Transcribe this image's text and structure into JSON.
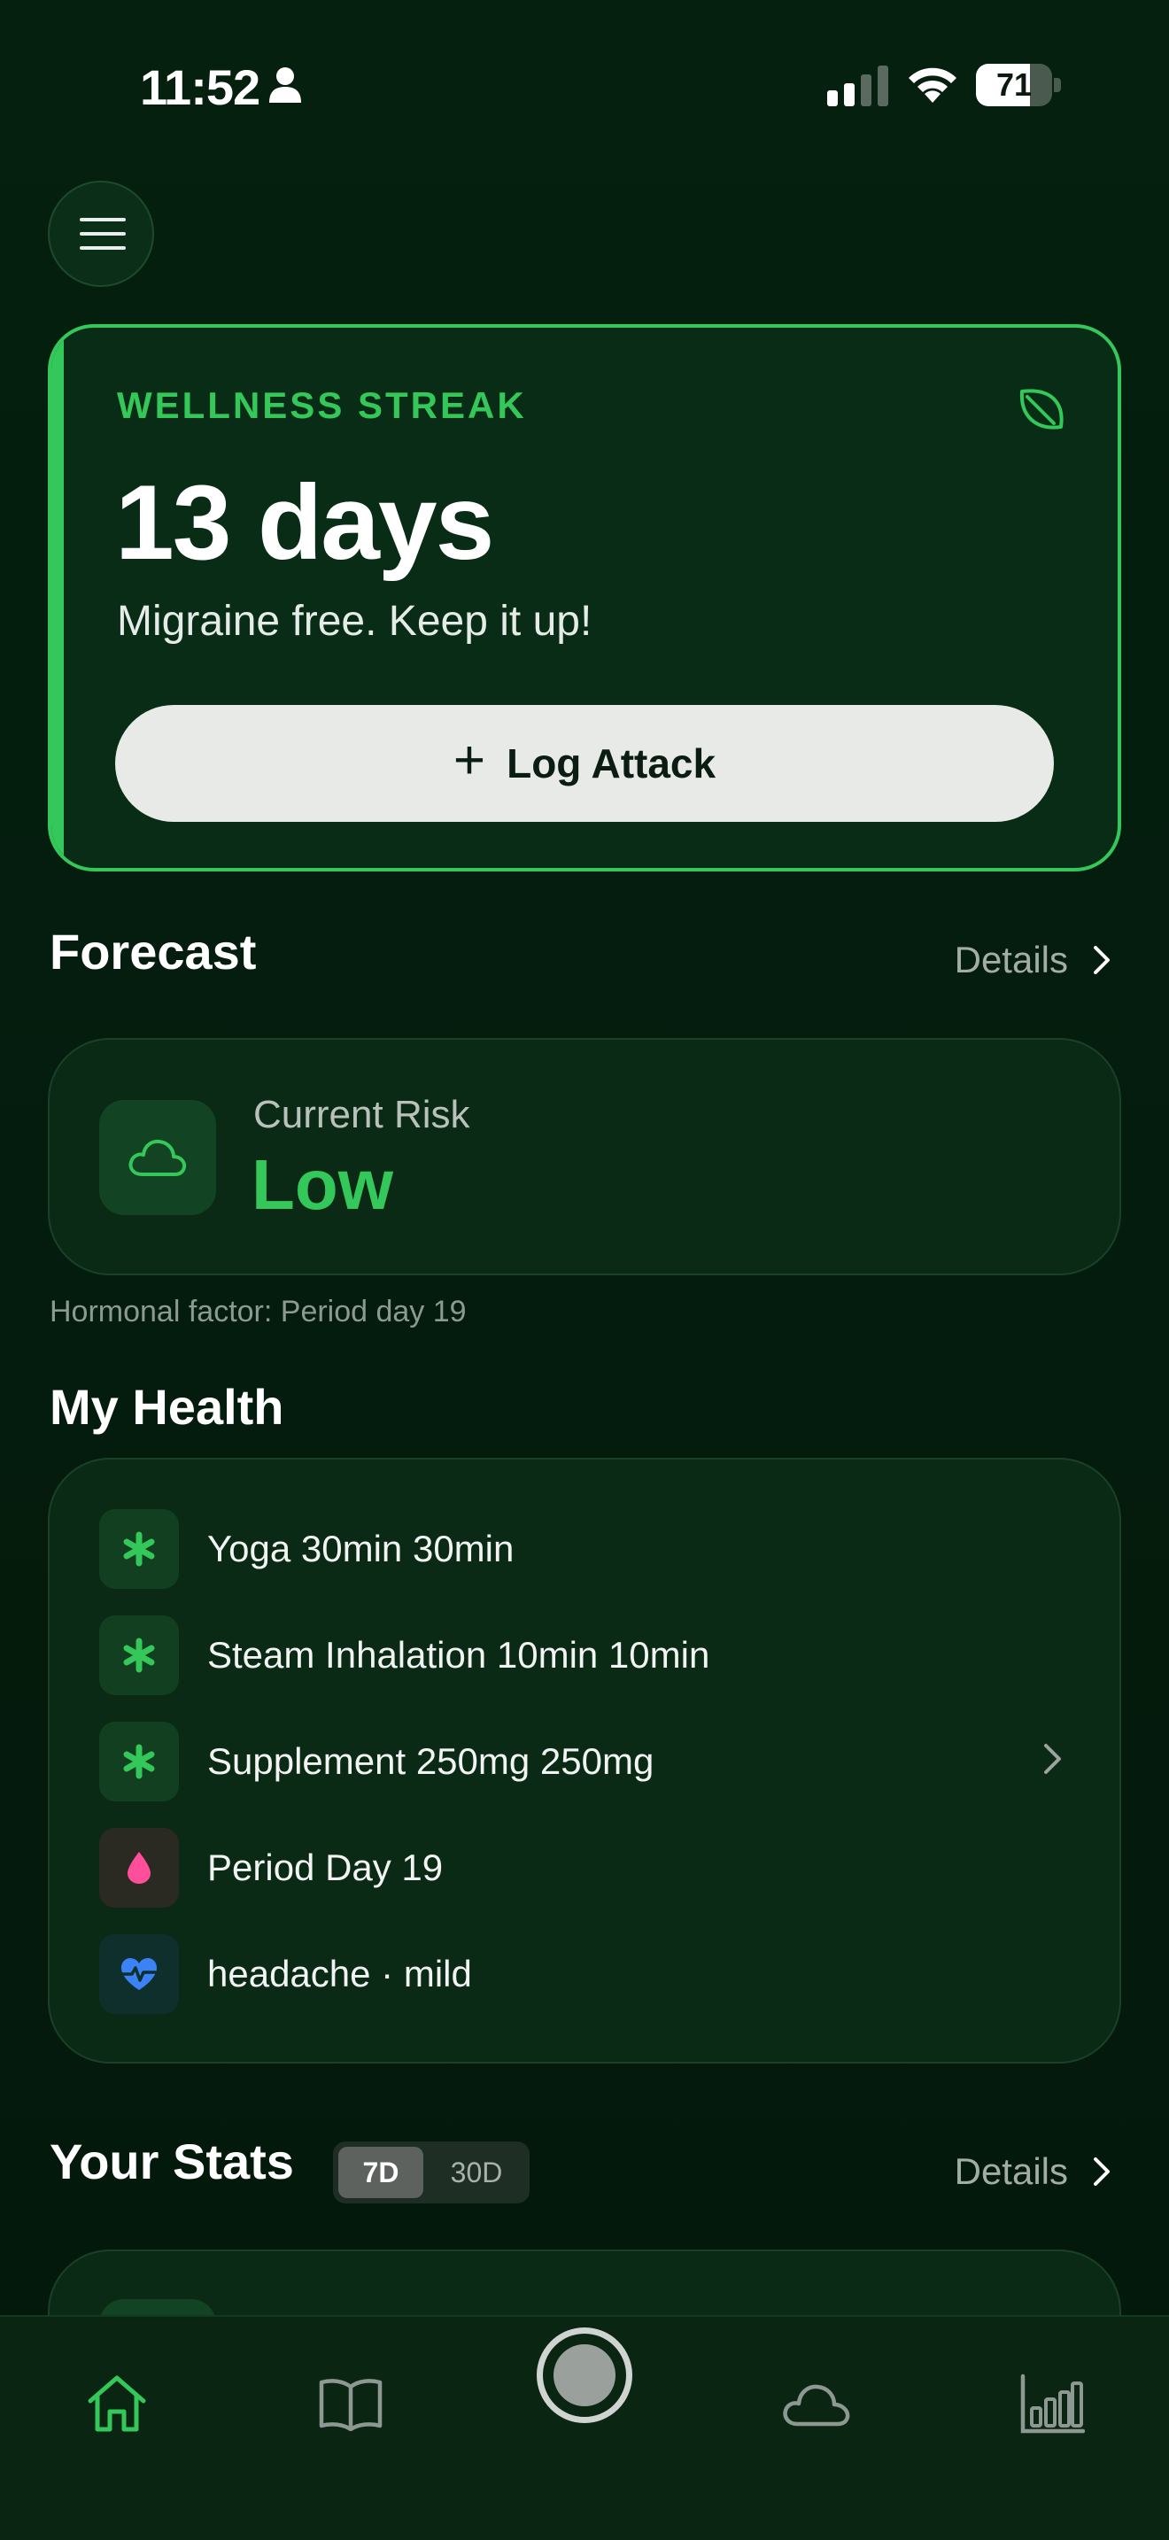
{
  "status_bar": {
    "time": "11:52",
    "battery": "71",
    "battery_level": 0.71
  },
  "menu": {
    "icon": "hamburger-menu-icon"
  },
  "streak": {
    "label": "WELLNESS STREAK",
    "count": "13 days",
    "subtitle": "Migraine free. Keep it up!",
    "log_button": "Log Attack",
    "icon": "leaf-icon",
    "accent_color": "#34c759"
  },
  "forecast": {
    "title": "Forecast",
    "details": "Details",
    "risk_label": "Current Risk",
    "risk_value": "Low",
    "note": "Hormonal factor: Period day 19",
    "icon": "cloud-icon"
  },
  "health": {
    "title": "My Health",
    "items": [
      {
        "label": "Yoga 30min 30min",
        "icon": "asterisk-icon",
        "color": "#34c759"
      },
      {
        "label": "Steam Inhalation 10min 10min",
        "icon": "asterisk-icon",
        "color": "#34c759"
      },
      {
        "label": "Supplement 250mg 250mg",
        "icon": "asterisk-icon",
        "color": "#34c759"
      },
      {
        "label": "Period Day 19",
        "icon": "drop-icon",
        "color": "#ff4f9a"
      },
      {
        "label": "headache · mild",
        "icon": "heart-pulse-icon",
        "color": "#3b82f6"
      }
    ]
  },
  "stats": {
    "title": "Your Stats",
    "details": "Details",
    "ranges": [
      "7D",
      "30D"
    ],
    "selected_range": "7D"
  },
  "tab_bar": {
    "tabs": [
      "home-icon",
      "book-icon",
      "record-button",
      "cloud-icon",
      "bar-chart-icon"
    ],
    "active": "home-icon"
  }
}
